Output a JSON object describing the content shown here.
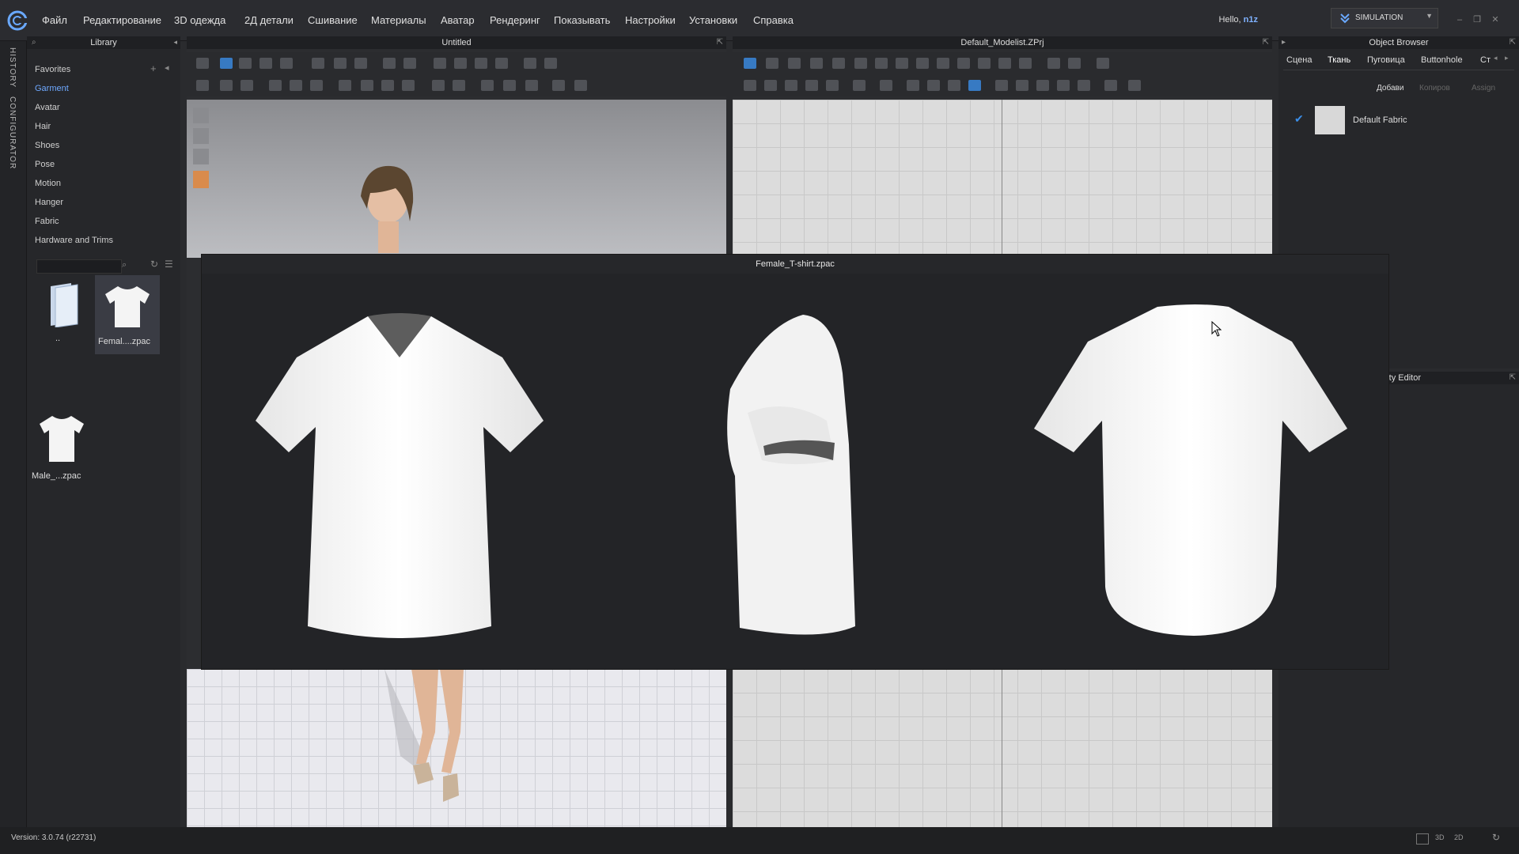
{
  "menu": [
    "Файл",
    "Редактирование",
    "3D одежда",
    "2Д детали",
    "Сшивание",
    "Материалы",
    "Аватар",
    "Рендеринг",
    "Показывать",
    "Настройки",
    "Установки",
    "Справка"
  ],
  "user": {
    "greeting": "Hello,",
    "name": "n1z"
  },
  "mode": "SIMULATION",
  "side_tabs": [
    "HISTORY",
    "CONFIGURATOR"
  ],
  "library": {
    "title": "Library",
    "items": [
      "Favorites",
      "Garment",
      "Avatar",
      "Hair",
      "Shoes",
      "Pose",
      "Motion",
      "Hanger",
      "Fabric",
      "Hardware and Trims"
    ],
    "active": "Garment",
    "files": [
      {
        "caption": "..",
        "icon": "folder-icon"
      },
      {
        "caption": "Femal....zpac",
        "icon": "tshirt-icon"
      },
      {
        "caption": "Male_...zpac",
        "icon": "tshirt-icon"
      }
    ]
  },
  "view3d": {
    "title": "Untitled"
  },
  "view2d": {
    "title": "Default_Modelist.ZPrj"
  },
  "object_browser": {
    "title": "Object Browser",
    "tabs": [
      "Сцена",
      "Ткань",
      "Пуговица",
      "Buttonhole",
      "Ст"
    ],
    "active_tab": "Ткань",
    "buttons": [
      "Добави",
      "Копиров",
      "Assign"
    ],
    "fabric": "Default Fabric"
  },
  "property_editor": {
    "title": "rty Editor"
  },
  "preview": {
    "title": "Female_T-shirt.zpac"
  },
  "status": {
    "version": "Version: 3.0.74    (r22731)"
  },
  "colors": {
    "accent": "#3b8ee8",
    "active_text": "#6ea8ff"
  }
}
